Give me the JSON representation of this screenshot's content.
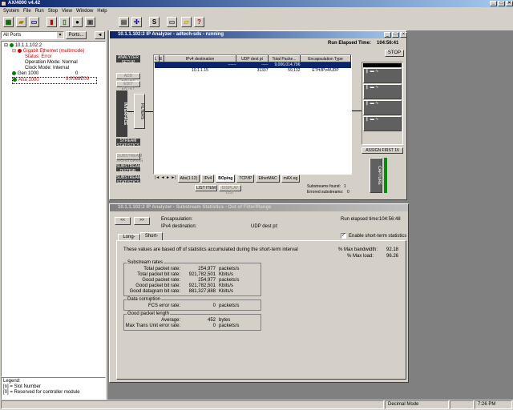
{
  "app": {
    "title": "AX/4000 v4.42"
  },
  "menu": [
    "System",
    "File",
    "Run",
    "Stop",
    "View",
    "Window",
    "Help"
  ],
  "toolbar": {
    "icons": [
      "module-icon",
      "folder-icon",
      "doc-icon",
      "record-icon",
      "run-icon",
      "stop-icon",
      "capture-icon",
      "gear-icon",
      "script-icon",
      "chart-icon",
      "folder-open-icon",
      "help-icon"
    ],
    "glyphs": [
      "▦",
      "▰",
      "▭",
      "▮",
      "▯",
      "●",
      "▣",
      "✣",
      "S",
      "▤",
      "▱",
      "?"
    ]
  },
  "left": {
    "port_select": "All Ports",
    "ports_button": "Ports...",
    "collapse": "◄",
    "tree": [
      {
        "text": "10.1.1.102:2",
        "color": "#000"
      },
      {
        "text": "Gigabit Ethernet (multimode)",
        "color": "#cc0000"
      },
      {
        "text": "Status: Error",
        "color": "#cc0000"
      },
      {
        "text": "Operation Mode: Normal",
        "color": "#000"
      },
      {
        "text": "Clock Mode: Internal",
        "color": "#000"
      },
      {
        "text": "Gen 1000",
        "color": "#000",
        "value": "0"
      },
      {
        "text": "Ana 1000",
        "color": "#cc0000",
        "value": "9.0068E09"
      }
    ],
    "legend": [
      "Legend:",
      "[n] = Slot Number",
      "[0] = Reserved for controller module"
    ]
  },
  "ipa": {
    "title": "10.1.1.102:2 IP Analyzer - adtech-sds - running",
    "run_elapsed_label": "Run Elapsed Time:",
    "run_elapsed": "104:56:41",
    "stop_button": "STOP",
    "side_buttons": [
      "ANALYZER SETUP",
      "ADD ENTRY",
      "EDIT ENTRY"
    ],
    "interface_label": "INTERFACE",
    "filters_label": "FILTERS",
    "stream_buttons": [
      "STREAM STATISTICS",
      "SUBSTREAM MONITORING",
      "SUBSTREAM DISTRIB.",
      "SUBSTREAM STATISTICS"
    ],
    "table": {
      "headers": [
        "L",
        "E",
        "IPv4 destination",
        "UDP dest pt",
        "Total Packe...",
        "Encapsulation Type"
      ],
      "rows": [
        [
          "",
          "",
          "------",
          "-----",
          "9,006,014,796",
          ""
        ],
        [
          "",
          "",
          "10.1.1.15",
          "31337",
          "59,132",
          "ETH/IPv4/UDP"
        ]
      ]
    },
    "tabs": [
      "Abs(1:12)",
      "IPv4",
      "BOping",
      "TCP/IP",
      "EtherMAC",
      "mAX.eg"
    ],
    "list_button": "LIST ITEM",
    "display_button": "DISPLAY LIST",
    "substreams_found_label": "Substreams found:",
    "substreams_found": "1",
    "errored_label": "Errored substreams:",
    "errored": "0",
    "assign_button": "ASSIGN FIRST 16",
    "capture_label": "CAPTURE"
  },
  "sub": {
    "title": "10.1.1.102:2 IP Analyzer - Substream Statistics - Out of Filter/Range",
    "nav": [
      "<<",
      ">>"
    ],
    "encap_label": "Encapsulation:",
    "ipv4_label": "IPv4 destination:",
    "udp_label": "UDP dest pt:",
    "elapsed_label": "Run elapsed time:",
    "elapsed": "104:56:48",
    "enable_label": "Enable short-term statistics",
    "tabs": [
      "Long-term",
      "Short-term"
    ],
    "note": "These values are based off of statistics accumulated during the short-term interval",
    "pct_bw_label": "% Max bandwidth:",
    "pct_bw": "92.18",
    "pct_load_label": "% Max load:",
    "pct_load": "96.26",
    "rates_title": "Substream rates",
    "rates": [
      [
        "Total packet rate:",
        "254,977",
        "packets/s"
      ],
      [
        "Total packet bit rate:",
        "921,782,501",
        "Kbits/s"
      ],
      [
        "Good packet rate:",
        "254,977",
        "packets/s"
      ],
      [
        "Good packet bit rate:",
        "921,782,501",
        "Kbits/s"
      ],
      [
        "Good datagram bit rate:",
        "881,327,888",
        "Kbits/s"
      ]
    ],
    "corrupt_title": "Data corruption",
    "corrupt": [
      [
        "FCS error rate:",
        "0",
        "packets/s"
      ]
    ],
    "length_title": "Good packet length",
    "length": [
      [
        "Average:",
        "452",
        "bytes"
      ],
      [
        "Max Trans Unit error rate:",
        "0",
        "packets/s"
      ]
    ]
  },
  "status": {
    "mode": "Decimal Mode",
    "time": "7:26 PM"
  }
}
